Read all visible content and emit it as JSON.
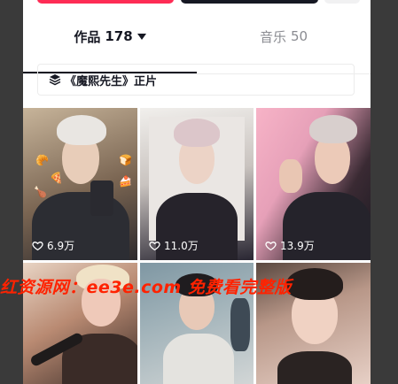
{
  "tabs": {
    "works": {
      "label": "作品",
      "count": "178"
    },
    "music": {
      "label": "音乐",
      "count": "50"
    }
  },
  "collection": {
    "label": "《魔熙先生》正片",
    "icon": "stack-icon"
  },
  "videos": [
    {
      "likes": "6.9万"
    },
    {
      "likes": "11.0万"
    },
    {
      "likes": "13.9万"
    },
    {
      "likes": ""
    },
    {
      "likes": ""
    },
    {
      "likes": ""
    }
  ],
  "watermark": "红资源网：ee3e.com 免费看完整版",
  "colors": {
    "accent": "#fe2c55",
    "dark": "#161823",
    "muted": "#8a8b91",
    "watermark": "#ff2200"
  }
}
